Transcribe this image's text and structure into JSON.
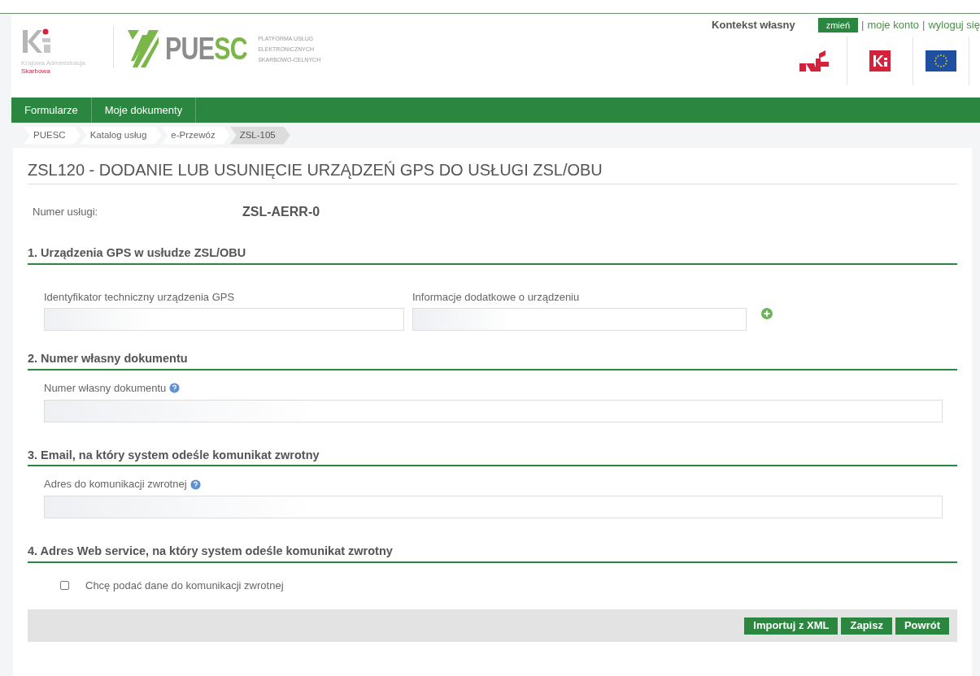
{
  "header": {
    "kas_logo": {
      "line1": "Krajowa Administracja",
      "line2": "Skarbowa"
    },
    "brand": {
      "name_grey": "PUE",
      "name_green": "SC",
      "tagline": [
        "PLATFORMA USŁUG",
        "ELEKTRONICZNYCH",
        "SKARBOWO-CELNYCH"
      ]
    },
    "context_label": "Kontekst własny",
    "change_button": "zmień",
    "links": [
      "moje konto",
      "wyloguj się"
    ],
    "separator": "|"
  },
  "nav": [
    {
      "label": "Formularze"
    },
    {
      "label": "Moje dokumenty"
    }
  ],
  "breadcrumbs": [
    {
      "label": "PUESC",
      "selected": false
    },
    {
      "label": "Katalog usług",
      "selected": false
    },
    {
      "label": "e-Przewóz",
      "selected": false
    },
    {
      "label": "ZSL-105",
      "selected": true
    }
  ],
  "page_title": "ZSL120 - DODANIE LUB USUNIĘCIE URZĄDZEŃ GPS DO USŁUGI ZSL/OBU",
  "service_number": {
    "label": "Numer usługi:",
    "value": "ZSL-AERR-0"
  },
  "sections": [
    {
      "heading": "1. Urządzenia GPS w usłudze ZSL/OBU",
      "kind": "device_pair",
      "fields": [
        {
          "label": "Identyfikator techniczny urządzenia GPS",
          "help": false
        },
        {
          "label": "Informacje dodatkowe o urządzeniu",
          "help": false
        }
      ]
    },
    {
      "heading": "2. Numer własny dokumentu",
      "kind": "field",
      "fields": [
        {
          "label": "Numer własny dokumentu",
          "help": true
        }
      ]
    },
    {
      "heading": "3. Email, na który system odeśle komunikat zwrotny",
      "kind": "field",
      "fields": [
        {
          "label": "Adres do komunikacji zwrotnej",
          "help": true
        }
      ]
    },
    {
      "heading": "4. Adres Web service, na który system odeśle komunikat zwrotny",
      "kind": "checkbox",
      "checkbox": {
        "label": "Chcę podać dane do komunikacji zwrotnej",
        "checked": false
      }
    }
  ],
  "buttons": [
    "Importuj z XML",
    "Zapisz",
    "Powrót"
  ]
}
